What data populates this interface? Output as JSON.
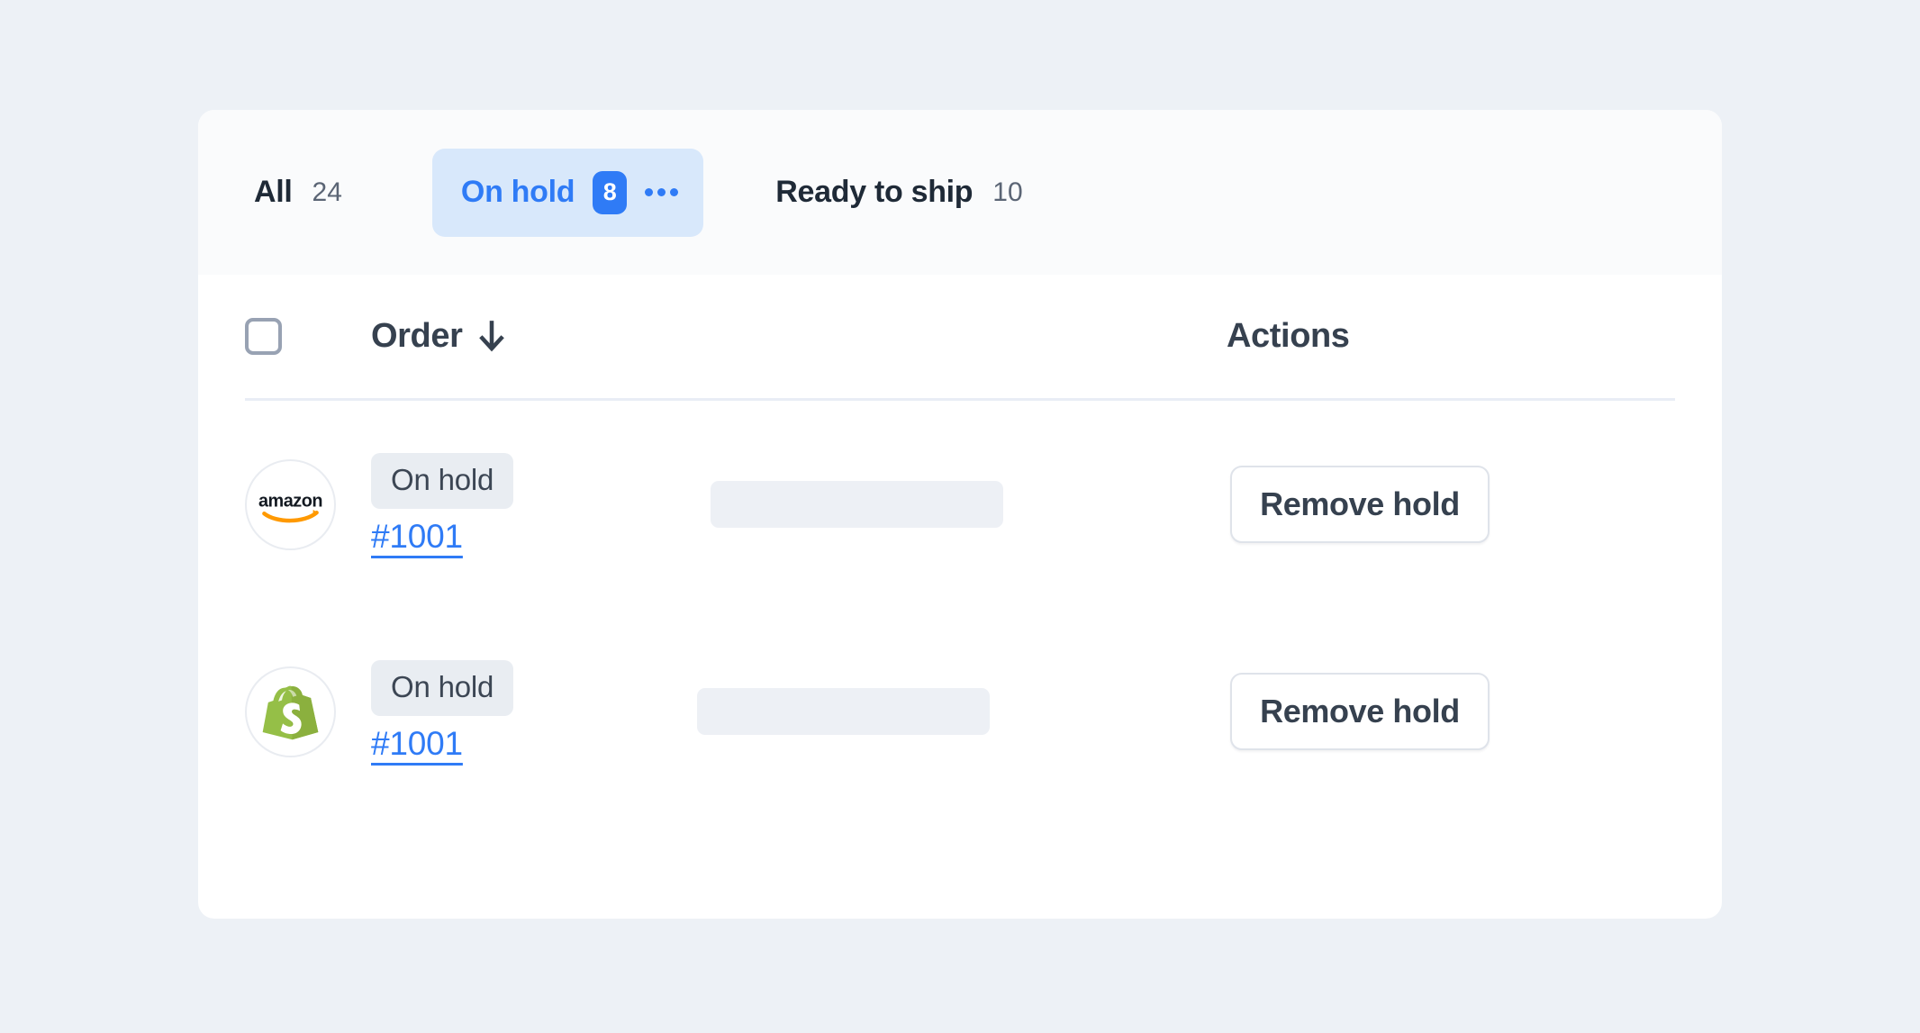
{
  "theme": {
    "page_background": "#edf1f6",
    "card_background": "#ffffff",
    "tabbar_background": "#fafbfc",
    "accent_blue": "#2f7bf6",
    "active_tab_background": "#d8e8fb",
    "badge_background": "#e9edf2",
    "skeleton_color": "#edf0f5",
    "divider_color": "#e9edf5",
    "text_dark": "#36414f"
  },
  "tabs": [
    {
      "label": "All",
      "count": "24",
      "active": false,
      "has_menu": false
    },
    {
      "label": "On hold",
      "count": "8",
      "active": true,
      "has_menu": true,
      "menu_icon": "ellipsis-horizontal-icon"
    },
    {
      "label": "Ready to ship",
      "count": "10",
      "active": false,
      "has_menu": false
    }
  ],
  "table": {
    "select_all": {
      "icon": "checkbox-unchecked-icon",
      "checked": false
    },
    "columns": [
      {
        "key": "order",
        "label": "Order",
        "sorted": true,
        "sort_icon": "arrow-down-icon"
      },
      {
        "key": "actions",
        "label": "Actions"
      }
    ],
    "rows": [
      {
        "channel": "amazon",
        "channel_icon": "amazon-logo-icon",
        "status": "On hold",
        "order_number": "#1001",
        "placeholder": "",
        "action_label": "Remove hold"
      },
      {
        "channel": "shopify",
        "channel_icon": "shopify-logo-icon",
        "status": "On hold",
        "order_number": "#1001",
        "placeholder": "",
        "action_label": "Remove hold"
      }
    ]
  }
}
